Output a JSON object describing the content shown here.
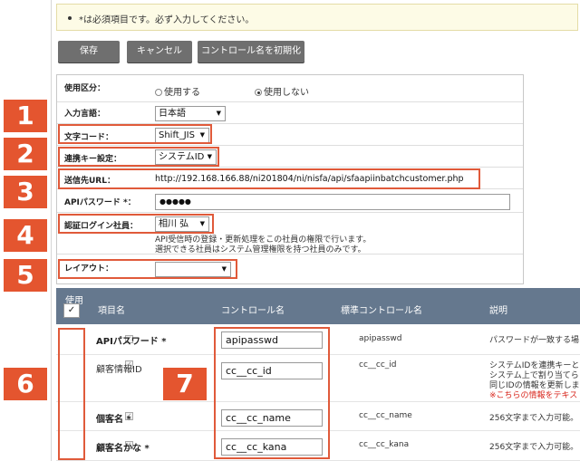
{
  "notice": "*は必須項目です。必ず入力してください。",
  "buttons": {
    "save": "保存",
    "cancel": "キャンセル",
    "reset": "コントロール名を初期化"
  },
  "form": {
    "usage": {
      "label": "使用区分：",
      "option_use": "使用する",
      "option_nouse": "使用しない",
      "selected": "使用しない"
    },
    "language": {
      "label": "入力言語：",
      "value": "日本語"
    },
    "charset": {
      "label": "文字コード：",
      "value": "Shift_JIS"
    },
    "link_key": {
      "label": "連携キー設定：",
      "value": "システムID"
    },
    "dest_url": {
      "label": "送信先URL：",
      "value": "http://192.168.166.88/ni201804/ni/nisfa/api/sfaapiinbatchcustomer.php"
    },
    "api_password": {
      "label": "APIパスワード *：",
      "value": "●●●●●"
    },
    "auth_user": {
      "label": "認証ログイン社員：",
      "value": "相川 弘",
      "note1": "API受信時の登録・更新処理をこの社員の権限で行います。",
      "note2": "選択できる社員はシステム管理権限を持つ社員のみです。"
    },
    "layout": {
      "label": "レイアウト：",
      "value": ""
    }
  },
  "table": {
    "headers": {
      "use": "使用",
      "item": "項目名",
      "control": "コントロール名",
      "standard": "標準コントロール名",
      "desc": "説明"
    },
    "check_mark": "✓",
    "rows": [
      {
        "item": "APIパスワード *",
        "control": "apipasswd",
        "standard": "apipasswd",
        "desc": "パスワードが一致する場"
      },
      {
        "item": "顧客情報ID",
        "control": "cc__cc_id",
        "standard": "cc__cc_id",
        "desc1": "システムIDを連携キーと",
        "desc2": "システム上で割り当てら",
        "desc3": "同じIDの情報を更新しま",
        "desc4": "※こちらの情報をテキス"
      },
      {
        "item": "個客名 *",
        "control": "cc__cc_name",
        "standard": "cc__cc_name",
        "desc": "256文字まで入力可能。"
      },
      {
        "item": "顧客名かな *",
        "control": "cc__cc_kana",
        "standard": "cc__cc_kana",
        "desc": "256文字まで入力可能。"
      }
    ]
  },
  "badges": [
    "1",
    "2",
    "3",
    "4",
    "5",
    "6",
    "7"
  ],
  "colors": {
    "accent": "#e4552f",
    "header": "#65788e",
    "button": "#6f6f6f"
  }
}
